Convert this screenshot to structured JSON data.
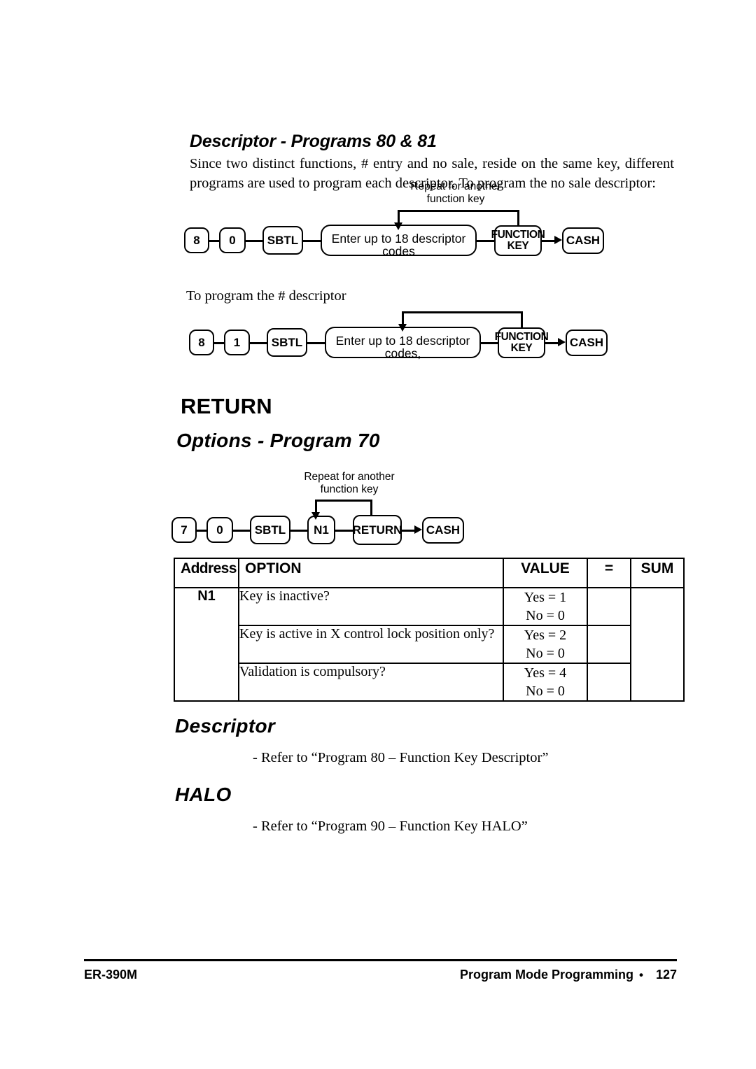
{
  "section_descriptor": {
    "heading": "Descriptor - Programs 80 & 81",
    "paragraph": "Since two distinct functions, # entry and no sale, reside on the same key, different programs are used to program each descriptor. To program the no sale descriptor:",
    "second_intro": "To program the # descriptor"
  },
  "flow1": {
    "loop_label": "Repeat for another\nfunction key",
    "nodes": [
      {
        "label": "8"
      },
      {
        "label": "0"
      },
      {
        "label": "SBTL"
      },
      {
        "label": "Enter up to 18 descriptor codes"
      },
      {
        "label": "FUNCTION\nKEY"
      },
      {
        "label": "CASH"
      }
    ]
  },
  "flow2": {
    "nodes": [
      {
        "label": "8"
      },
      {
        "label": "1"
      },
      {
        "label": "SBTL"
      },
      {
        "label": "Enter up to 18 descriptor codes,"
      },
      {
        "label": "FUNCTION\nKEY"
      },
      {
        "label": "CASH"
      }
    ]
  },
  "section_return": {
    "heading": "RETURN",
    "options_heading": "Options - Program 70"
  },
  "flow3": {
    "loop_label": "Repeat for another\nfunction key",
    "nodes": [
      {
        "label": "7"
      },
      {
        "label": "0"
      },
      {
        "label": "SBTL"
      },
      {
        "label": "N1"
      },
      {
        "label": "RETURN"
      },
      {
        "label": "CASH"
      }
    ]
  },
  "options_table": {
    "headers": {
      "address": "Address",
      "option": "OPTION",
      "value": "VALUE",
      "equals": "=",
      "sum": "SUM"
    },
    "address": "N1",
    "rows": [
      {
        "option": "Key is inactive?",
        "yes": "Yes = 1",
        "no": "No = 0"
      },
      {
        "option": "Key is active in X control lock position only?",
        "yes": "Yes = 2",
        "no": "No = 0"
      },
      {
        "option": "Validation is compulsory?",
        "yes": "Yes = 4",
        "no": "No = 0"
      }
    ]
  },
  "section_descriptor2": {
    "heading": "Descriptor",
    "text": "- Refer to “Program 80 – Function Key Descriptor”"
  },
  "section_halo": {
    "heading": "HALO",
    "text": "- Refer to “Program 90 – Function Key HALO”"
  },
  "footer": {
    "model": "ER-390M",
    "title": "Program Mode Programming",
    "bullet": "•",
    "page": "127"
  }
}
